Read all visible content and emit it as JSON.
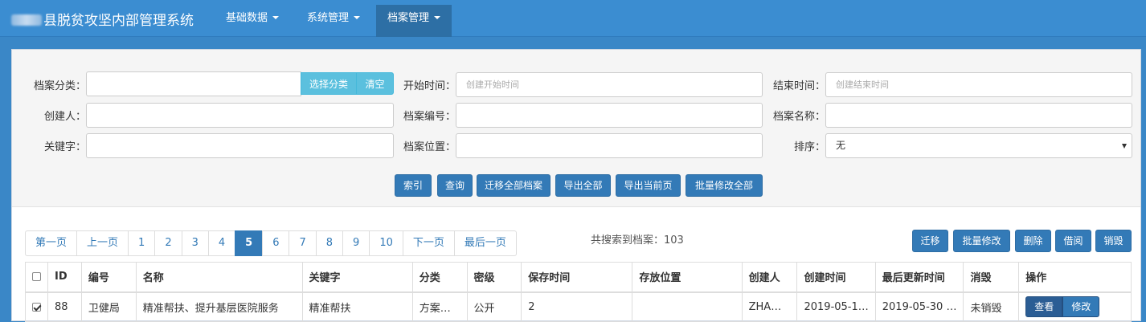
{
  "navbar": {
    "brand": "县脱贫攻坚内部管理系统",
    "menus": [
      {
        "label": "基础数据"
      },
      {
        "label": "系统管理"
      },
      {
        "label": "档案管理"
      }
    ]
  },
  "filter": {
    "category_label": "档案分类：",
    "category_value": "",
    "choose_category": "选择分类",
    "clear": "清空",
    "start_label": "开始时间：",
    "start_placeholder": "创建开始时间",
    "end_label": "结束时间：",
    "end_placeholder": "创建结束时间",
    "creator_label": "创建人：",
    "archive_no_label": "档案编号：",
    "archive_name_label": "档案名称：",
    "keyword_label": "关键字：",
    "location_label": "档案位置：",
    "sort_label": "排序：",
    "sort_value": "无",
    "buttons": [
      "索引",
      "查询",
      "迁移全部档案",
      "导出全部",
      "导出当前页",
      "批量修改全部"
    ]
  },
  "pagination": {
    "first": "第一页",
    "prev": "上一页",
    "pages": [
      "1",
      "2",
      "3",
      "4",
      "5",
      "6",
      "7",
      "8",
      "9",
      "10"
    ],
    "current": "5",
    "next": "下一页",
    "last": "最后一页"
  },
  "result_text": "共搜索到档案：103",
  "actions": [
    "迁移",
    "批量修改",
    "删除",
    "借阅",
    "销毁"
  ],
  "table": {
    "headers": [
      "ID",
      "编号",
      "名称",
      "关键字",
      "分类",
      "密级",
      "保存时间",
      "存放位置",
      "创建人",
      "创建时间",
      "最后更新时间",
      "消毁",
      "操作"
    ],
    "rows": [
      {
        "checked": true,
        "id": "88",
        "code": "卫健局",
        "name": "精准帮扶、提升基层医院服务",
        "keyword": "精准帮扶",
        "category": "方案…",
        "secret": "公开",
        "keep": "2",
        "location": "",
        "creator": "ZHA…",
        "created": "2019-05-1…",
        "updated": "2019-05-30 …",
        "destroy": "未销毁",
        "view": "查看",
        "edit": "修改"
      }
    ]
  },
  "colors": {
    "navbar": "#3b8dd1",
    "primary": "#337ab7",
    "info": "#5bc0de"
  }
}
